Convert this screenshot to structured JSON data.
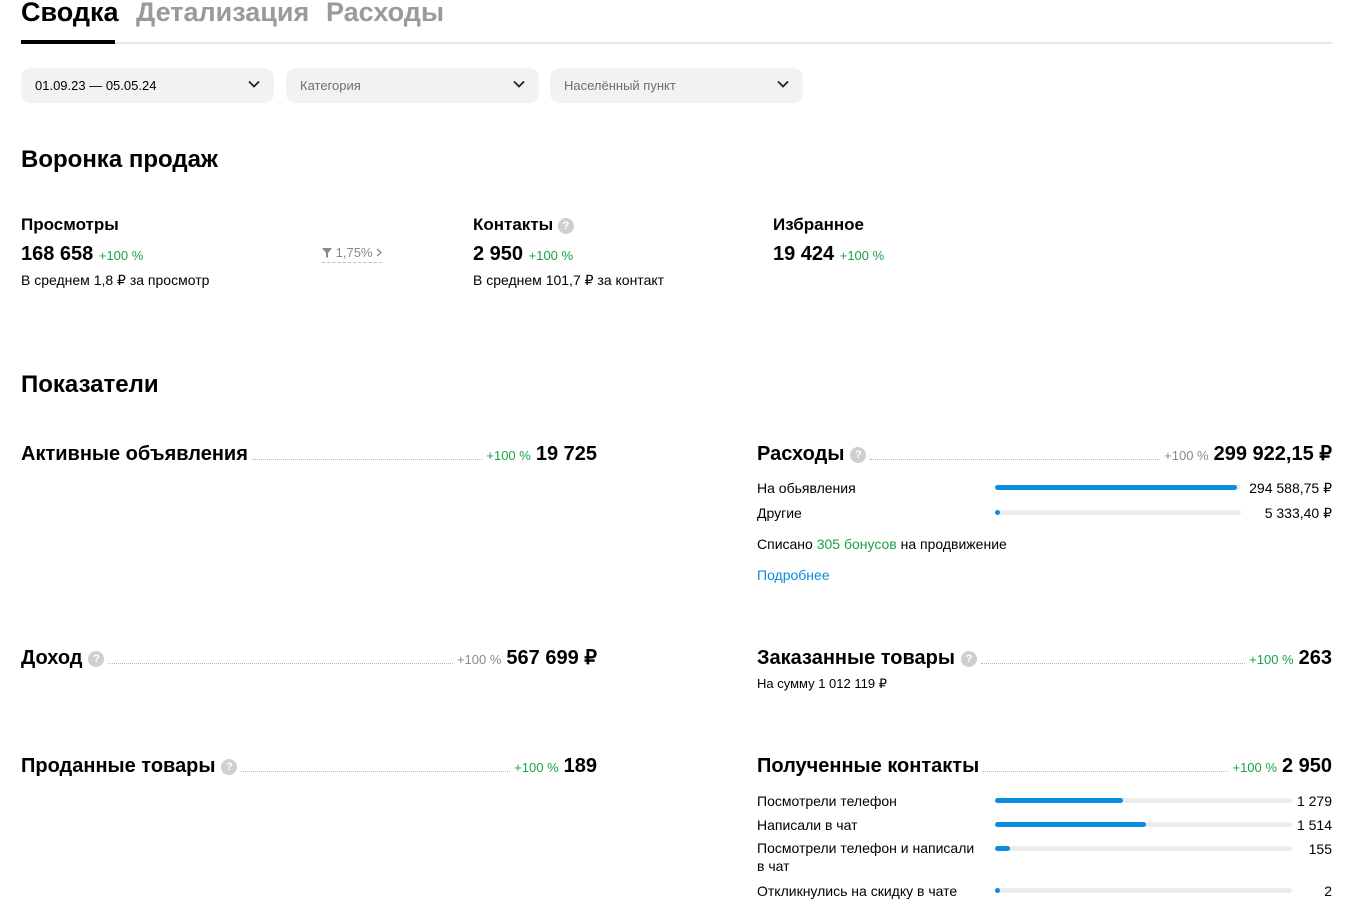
{
  "tabs": [
    {
      "label": "Сводка",
      "active": true
    },
    {
      "label": "Детализация",
      "active": false
    },
    {
      "label": "Расходы",
      "active": false
    }
  ],
  "filters": {
    "period": "01.09.23 — 05.05.24",
    "category_placeholder": "Категория",
    "city_placeholder": "Населённый пункт"
  },
  "funnel": {
    "title": "Воронка продаж",
    "views": {
      "label": "Просмотры",
      "value": "168 658",
      "delta": "+100 %",
      "avg": "В среднем 1,8 ₽ за просмотр"
    },
    "conversion": "1,75%",
    "contacts": {
      "label": "Контакты",
      "value": "2 950",
      "delta": "+100 %",
      "avg": "В среднем 101,7 ₽ за контакт"
    },
    "favorites": {
      "label": "Избранное",
      "value": "19 424",
      "delta": "+100 %"
    }
  },
  "indicators": {
    "title": "Показатели",
    "active_ads": {
      "label": "Активные объявления",
      "delta": "+100 %",
      "value": "19 725"
    },
    "expenses": {
      "label": "Расходы",
      "delta": "+100 %",
      "value": "299 922,15 ₽",
      "rows": [
        {
          "label": "На обьявления",
          "value": "294 588,75 ₽",
          "share": 0.982
        },
        {
          "label": "Другие",
          "value": "5 333,40 ₽",
          "share": 0.018
        }
      ],
      "bonus_prefix": "Списано",
      "bonus_amount": "305 бонусов",
      "bonus_suffix": "на продвижение",
      "more_link": "Подробнее"
    },
    "income": {
      "label": "Доход",
      "delta": "+100 %",
      "value": "567 699 ₽"
    },
    "ordered": {
      "label": "Заказанные товары",
      "delta": "+100 %",
      "value": "263",
      "sum": "На сумму 1 012 119 ₽"
    },
    "sold": {
      "label": "Проданные товары",
      "delta": "+100 %",
      "value": "189"
    },
    "contacts_received": {
      "label": "Полученные контакты",
      "delta": "+100 %",
      "value": "2 950",
      "rows": [
        {
          "label": "Посмотрели телефон",
          "value": "1 279",
          "share": 0.43
        },
        {
          "label": "Написали в чат",
          "value": "1 514",
          "share": 0.51
        },
        {
          "label": "Посмотрели телефон и написали",
          "label2": "в чат",
          "value": "155",
          "share": 0.052
        },
        {
          "label": "Откликнулись на скидку в чате",
          "value": "2",
          "share": 0.001
        }
      ]
    }
  },
  "colors": {
    "accent": "#0a8ee0",
    "positive": "#1aa24b",
    "muted": "#8a8a8a"
  },
  "icons": {
    "chevron": "chevron-down-icon",
    "help": "question-icon",
    "filter": "funnel-icon"
  }
}
